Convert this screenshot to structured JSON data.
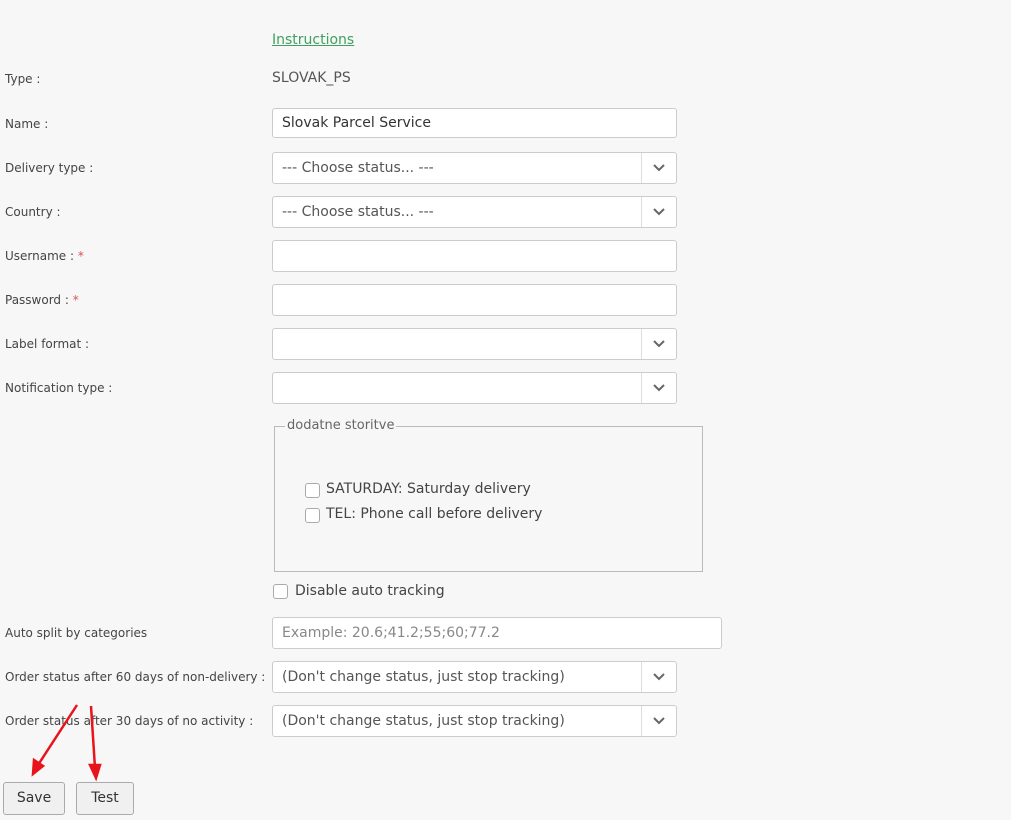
{
  "instructions_link": "Instructions",
  "type": {
    "label": "Type :",
    "value": "SLOVAK_PS"
  },
  "name": {
    "label": "Name :",
    "value": "Slovak Parcel Service"
  },
  "delivery_type": {
    "label": "Delivery type :",
    "value": "--- Choose status... ---"
  },
  "country": {
    "label": "Country :",
    "value": "--- Choose status... ---"
  },
  "username": {
    "label": "Username :",
    "required": "*",
    "value": ""
  },
  "password": {
    "label": "Password :",
    "required": "*",
    "value": ""
  },
  "label_format": {
    "label": "Label format :",
    "value": ""
  },
  "notification_type": {
    "label": "Notification type :",
    "value": ""
  },
  "extra_services": {
    "legend": "dodatne storitve",
    "options": [
      {
        "label": "SATURDAY: Saturday delivery",
        "checked": false
      },
      {
        "label": "TEL: Phone call before delivery",
        "checked": false
      }
    ]
  },
  "disable_tracking": {
    "label": "Disable auto tracking",
    "checked": false
  },
  "auto_split": {
    "label": "Auto split by categories",
    "placeholder": "Example: 20.6;41.2;55;60;77.2",
    "value": ""
  },
  "status_60": {
    "label": "Order status after 60 days of non-delivery :",
    "value": "(Don't change status, just stop tracking)"
  },
  "status_30": {
    "label": "Order status after 30 days of no activity :",
    "value": "(Don't change status, just stop tracking)"
  },
  "buttons": {
    "save": "Save",
    "test": "Test"
  },
  "colors": {
    "link": "#3fa05f",
    "required": "#d9534f",
    "annotation_arrow": "#e8141c"
  }
}
